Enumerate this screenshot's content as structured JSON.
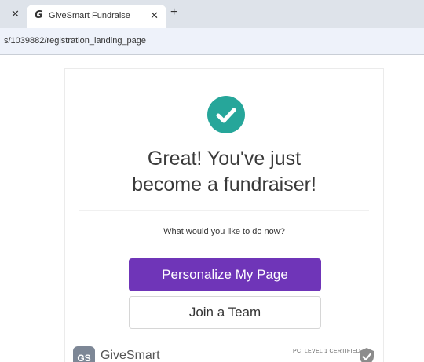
{
  "browser": {
    "tab_title": "GiveSmart Fundraise",
    "tab_favicon": "G",
    "close_glyph": "✕",
    "new_tab_glyph": "+",
    "url": "s/1039882/registration_landing_page"
  },
  "card": {
    "headline_line1": "Great! You've just",
    "headline_line2": "become a fundraiser!",
    "question": "What would you like to do now?",
    "primary_button": "Personalize My Page",
    "secondary_button": "Join a Team"
  },
  "footer": {
    "logo_mark": "GS",
    "logo_text": "GiveSmart",
    "pci_text": "PCI LEVEL 1 CERTIFIED"
  },
  "colors": {
    "accent": "#6f35b8",
    "success": "#26a69a"
  },
  "icons": [
    "close-icon",
    "givesmart-favicon-icon",
    "plus-icon",
    "check-circle-icon",
    "shield-check-icon"
  ]
}
